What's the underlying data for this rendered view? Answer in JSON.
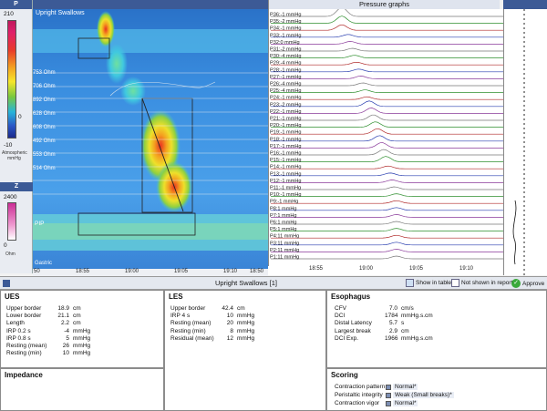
{
  "scale": {
    "p_label": "P",
    "p_max": "210",
    "p_min": "-10",
    "p_tick": "0",
    "p_unit_lines": [
      "Atmospheric",
      "mmHg"
    ],
    "z_label": "Z",
    "z_max": "2400",
    "z_min": "0",
    "z_unit": "Ohm"
  },
  "topo": {
    "title": "Upright Swallows",
    "left_labels": [
      "753 Ohm",
      "706 Ohm",
      "892 Ohm",
      "628 Ohm",
      "608 Ohm",
      "492 Ohm",
      "553 Ohm",
      "514 Ohm"
    ],
    "markers": [
      "PIP",
      "Gastric"
    ],
    "x_ticks": [
      "50",
      "18:55",
      "19:00",
      "19:05",
      "19:10",
      "18:50"
    ]
  },
  "pressure": {
    "title": "Pressure graphs",
    "channel_labels": [
      "P36:-1 mmHg",
      "P35:-2 mmHg",
      "P34:-1 mmHg",
      "P33:-1 mmHg",
      "P32:0 mmHg",
      "P31:-2 mmHg",
      "P30:-4 mmHg",
      "P29:-4 mmHg",
      "P28:-1 mmHg",
      "P27:-1 mmHg",
      "P26:-4 mmHg",
      "P25:-4 mmHg",
      "P24:-1 mmHg",
      "P23:-2 mmHg",
      "P22:-1 mmHg",
      "P21:-1 mmHg",
      "P20:-1 mmHg",
      "P19:-1 mmHg",
      "P18:-1 mmHg",
      "P17:-1 mmHg",
      "P16:-1 mmHg",
      "P15:-1 mmHg",
      "P14:-1 mmHg",
      "P13:-1 mmHg",
      "P12:-1 mmHg",
      "P11:-1 mmHg",
      "P10:-1 mmHg",
      "P9:-1 mmHg",
      "P8:1 mmHg",
      "P7:1 mmHg",
      "P6:1 mmHg",
      "P5:1 mmHg",
      "P4:11 mmHg",
      "P3:11 mmHg",
      "P2:11 mmHg",
      "P1:11 mmHg"
    ],
    "x_ticks": [
      "18:55",
      "19:00",
      "19:05",
      "19:10"
    ],
    "colors": [
      "#7a7a7a",
      "#2f8f2f",
      "#b02a2a",
      "#2a3fb0",
      "#8a3a9a"
    ]
  },
  "toolbar": {
    "title": "Upright Swallows [1]",
    "show_in_table": "Show in table",
    "not_shown": "Not shown in report",
    "approve": "Approve"
  },
  "ues": {
    "title": "UES",
    "rows": [
      {
        "k": "Upper border",
        "v": "18.9",
        "u": "cm"
      },
      {
        "k": "Lower border",
        "v": "21.1",
        "u": "cm"
      },
      {
        "k": "Length",
        "v": "2.2",
        "u": "cm"
      },
      {
        "k": "IRP 0.2 s",
        "v": "-4",
        "u": "mmHg"
      },
      {
        "k": "IRP 0.8 s",
        "v": "5",
        "u": "mmHg"
      },
      {
        "k": "Resting (mean)",
        "v": "26",
        "u": "mmHg"
      },
      {
        "k": "Resting (min)",
        "v": "10",
        "u": "mmHg"
      }
    ]
  },
  "impedance": {
    "title": "Impedance"
  },
  "les": {
    "title": "LES",
    "rows": [
      {
        "k": "Upper border",
        "v": "42.4",
        "u": "cm"
      },
      {
        "k": "IRP 4 s",
        "v": "10",
        "u": "mmHg"
      },
      {
        "k": "Resting (mean)",
        "v": "20",
        "u": "mmHg"
      },
      {
        "k": "Resting (min)",
        "v": "8",
        "u": "mmHg"
      },
      {
        "k": "Residual (mean)",
        "v": "12",
        "u": "mmHg"
      }
    ]
  },
  "esophagus": {
    "title": "Esophagus",
    "rows": [
      {
        "k": "CFV",
        "v": "7.0",
        "u": "cm/s"
      },
      {
        "k": "DCI",
        "v": "1784",
        "u": "mmHg.s.cm"
      },
      {
        "k": "Distal Latency",
        "v": "5.7",
        "u": "s"
      },
      {
        "k": "Largest break",
        "v": "2.9",
        "u": "cm"
      },
      {
        "k": "DCI Exp.",
        "v": "1966",
        "u": "mmHg.s.cm"
      }
    ]
  },
  "scoring": {
    "title": "Scoring",
    "rows": [
      {
        "k": "Contraction pattern",
        "v": "Normal*"
      },
      {
        "k": "Peristaltic integrity",
        "v": "Weak (Small breaks)*"
      },
      {
        "k": "Contraction vigor",
        "v": "Normal*"
      }
    ]
  }
}
